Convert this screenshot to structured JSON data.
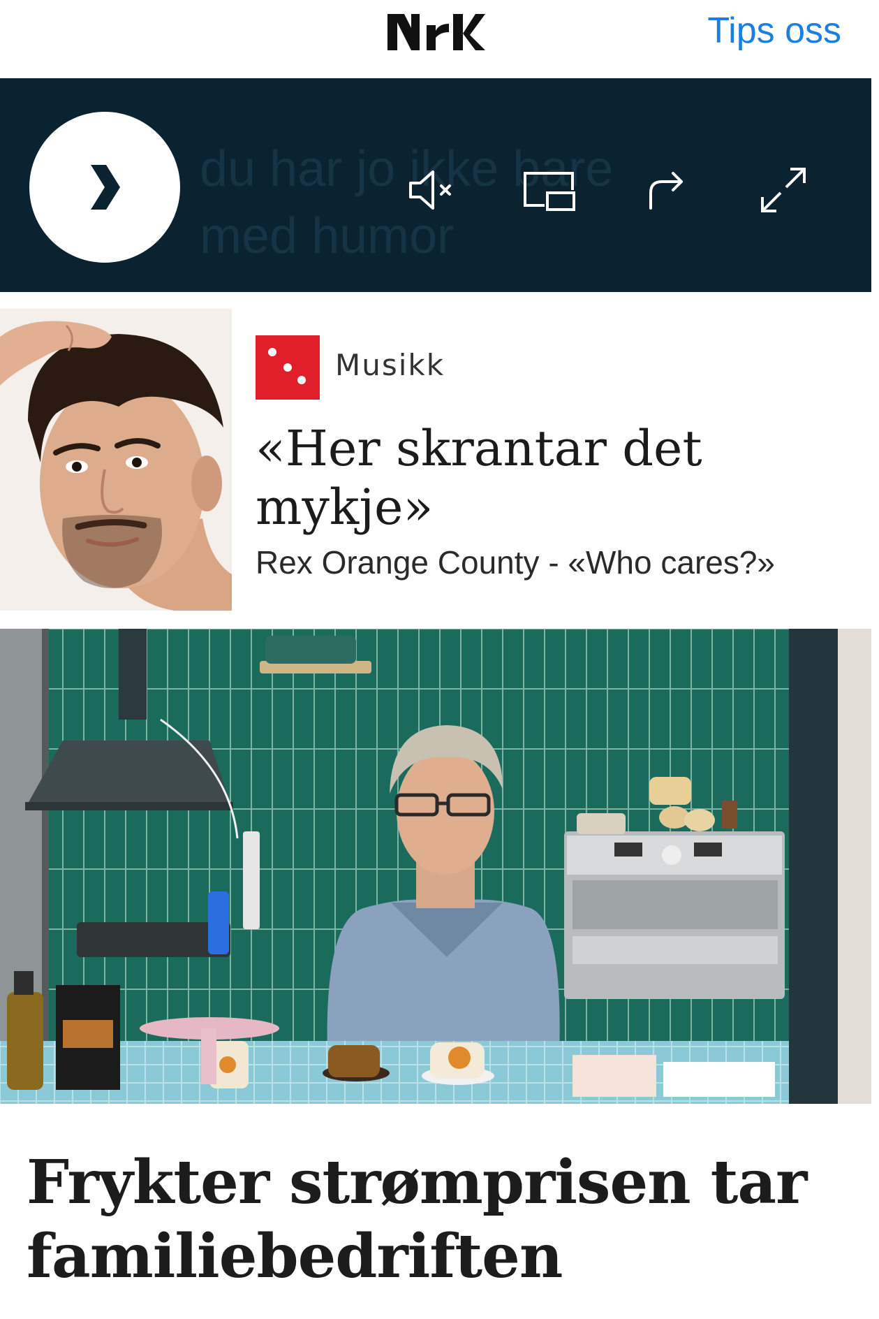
{
  "header": {
    "logo_text": "NRK",
    "tips_label": "Tips oss"
  },
  "player": {
    "ghost_caption": "du har jo ikke bare\nmed humor",
    "controls": [
      "play-icon",
      "mute-icon",
      "picture-in-picture-icon",
      "share-icon",
      "fullscreen-icon"
    ]
  },
  "teaser": {
    "category": "Musikk",
    "title": "«Her skrantar det mykje»",
    "subtitle": "Rex Orange County - «Who cares?»"
  },
  "story": {
    "headline": "Frykter strømprisen tar familiebedriften"
  },
  "colors": {
    "accent_link": "#1a7fe0",
    "player_bg": "#0b2230",
    "category_red": "#e01f2b"
  }
}
